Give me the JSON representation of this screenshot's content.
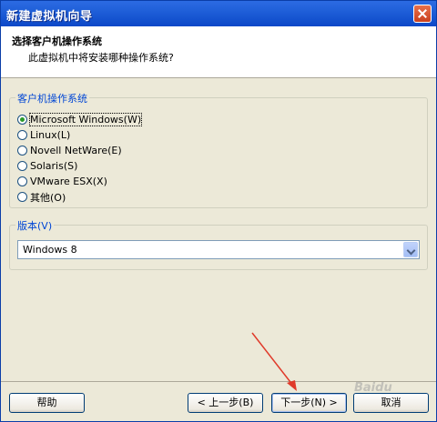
{
  "window": {
    "title": "新建虚拟机向导"
  },
  "header": {
    "title": "选择客户机操作系统",
    "subtitle": "此虚拟机中将安装哪种操作系统?"
  },
  "os_group": {
    "legend": "客户机操作系统",
    "options": [
      {
        "label": "Microsoft Windows(W)",
        "checked": true
      },
      {
        "label": "Linux(L)",
        "checked": false
      },
      {
        "label": "Novell NetWare(E)",
        "checked": false
      },
      {
        "label": "Solaris(S)",
        "checked": false
      },
      {
        "label": "VMware ESX(X)",
        "checked": false
      },
      {
        "label": "其他(O)",
        "checked": false
      }
    ]
  },
  "version_group": {
    "legend": "版本(V)",
    "selected": "Windows 8"
  },
  "buttons": {
    "help": "帮助",
    "back": "< 上一步(B)",
    "next": "下一步(N) >",
    "cancel": "取消"
  },
  "watermark": "Baidu",
  "colors": {
    "titlebar": "#0c48c8",
    "legend": "#0046d5",
    "annotation_arrow": "#e03a2a"
  }
}
